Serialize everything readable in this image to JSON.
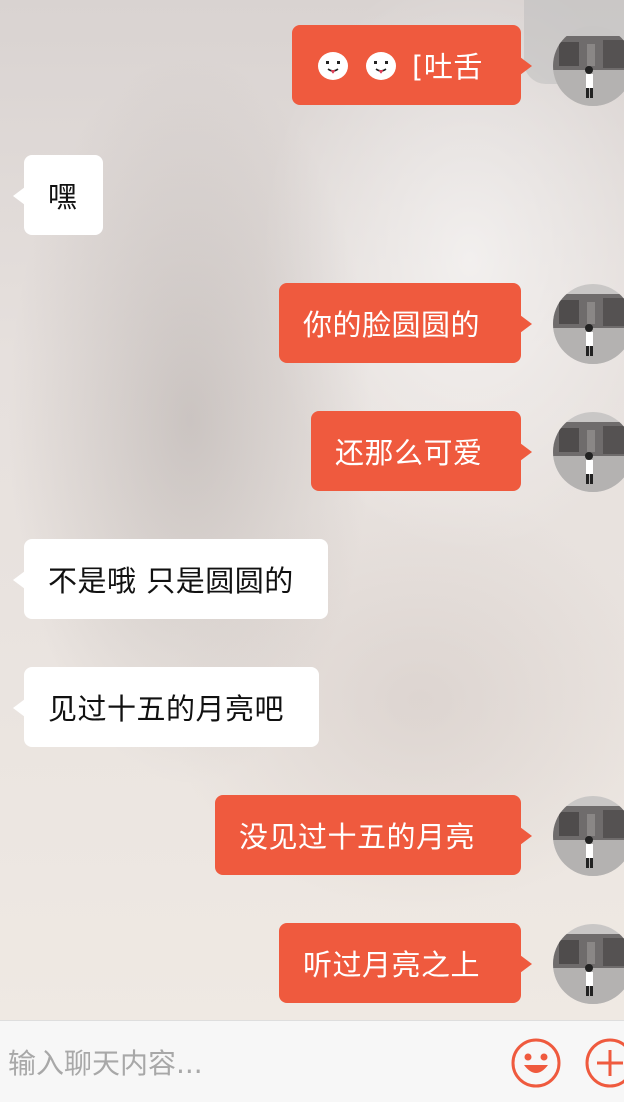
{
  "colors": {
    "outgoing_bubble": "#ef5a3e",
    "incoming_bubble": "#ffffff",
    "accent": "#ef5a3e"
  },
  "messages": [
    {
      "direction": "outgoing",
      "text": "[吐舌",
      "emoji_prefix": [
        "tongue-out-emoji",
        "tongue-out-emoji"
      ]
    },
    {
      "direction": "incoming",
      "text": "嘿"
    },
    {
      "direction": "outgoing",
      "text": "你的脸圆圆的"
    },
    {
      "direction": "outgoing",
      "text": "还那么可爱"
    },
    {
      "direction": "incoming",
      "text": "不是哦 只是圆圆的"
    },
    {
      "direction": "incoming",
      "text": "见过十五的月亮吧"
    },
    {
      "direction": "outgoing",
      "text": "没见过十五的月亮"
    },
    {
      "direction": "outgoing",
      "text": "听过月亮之上"
    }
  ],
  "composer": {
    "placeholder": "输入聊天内容...",
    "emoji_button_icon": "smiley-face-icon",
    "plus_button_icon": "plus-circle-icon"
  }
}
